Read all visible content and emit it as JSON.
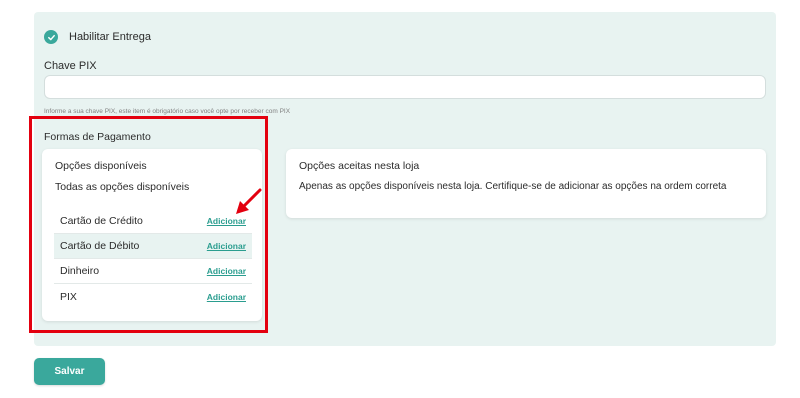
{
  "form": {
    "enable_delivery_label": "Habilitar Entrega",
    "enable_delivery_checked": true,
    "pix_key_label": "Chave PIX",
    "pix_key_value": "",
    "pix_key_hint": "Informe a sua chave PIX, este item é obrigatório caso você opte por receber com PIX"
  },
  "payment": {
    "title": "Formas de Pagamento",
    "available": {
      "title": "Opções disponíveis",
      "subtitle": "Todas as opções disponíveis",
      "items": [
        {
          "label": "Cartão de Crédito",
          "action": "Adicionar"
        },
        {
          "label": "Cartão de Débito",
          "action": "Adicionar"
        },
        {
          "label": "Dinheiro",
          "action": "Adicionar"
        },
        {
          "label": "PIX",
          "action": "Adicionar"
        }
      ]
    },
    "accepted": {
      "title": "Opções aceitas nesta loja",
      "subtitle": "Apenas as opções disponíveis nesta loja. Certifique-se de adicionar as opções na ordem correta"
    }
  },
  "actions": {
    "save_label": "Salvar"
  },
  "colors": {
    "accent": "#3aa89c",
    "link": "#2a9d8f",
    "panel_background": "#e8f3f1",
    "annotation": "#e3000f"
  },
  "icons": {
    "enable_check": "check-circle-icon",
    "annotation_arrow": "red-arrow-icon"
  }
}
